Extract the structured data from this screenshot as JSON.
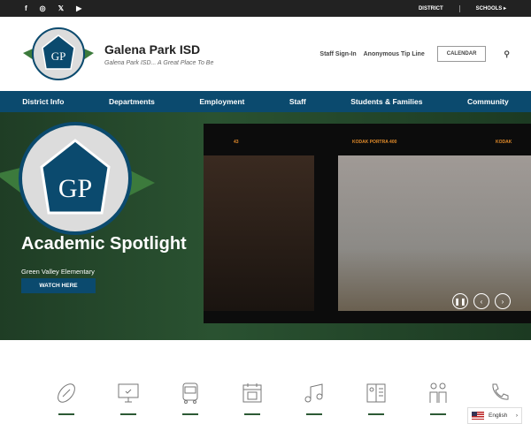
{
  "topbar": {
    "social": [
      "facebook-icon",
      "instagram-icon",
      "x-icon",
      "youtube-icon"
    ],
    "district": "DISTRICT",
    "schools": "SCHOOLS ▸"
  },
  "header": {
    "title": "Galena Park ISD",
    "tagline": "Galena Park ISD... A Great Place To Be",
    "links": [
      "Staff Sign-In",
      "Anonymous Tip Line"
    ],
    "calendar": "CALENDAR"
  },
  "nav": [
    "District Info",
    "Departments",
    "Employment",
    "Staff",
    "Students & Families",
    "Community"
  ],
  "hero": {
    "heading": "Academic Spotlight",
    "school": "Green Valley Elementary",
    "button": "WATCH HERE",
    "film": [
      "43",
      "KODAK PORTRA 400",
      "KODAK PORTRA 400",
      "43",
      "KODAK"
    ]
  },
  "quick_icons": [
    "football-icon",
    "monitor-check-icon",
    "bus-icon",
    "calendar-icon",
    "music-icon",
    "menu-book-icon",
    "family-icon",
    "phone-icon"
  ],
  "language": "English",
  "colors": {
    "nav": "#0b4a6e",
    "accent": "#2d5a35",
    "topbar": "#222222"
  }
}
